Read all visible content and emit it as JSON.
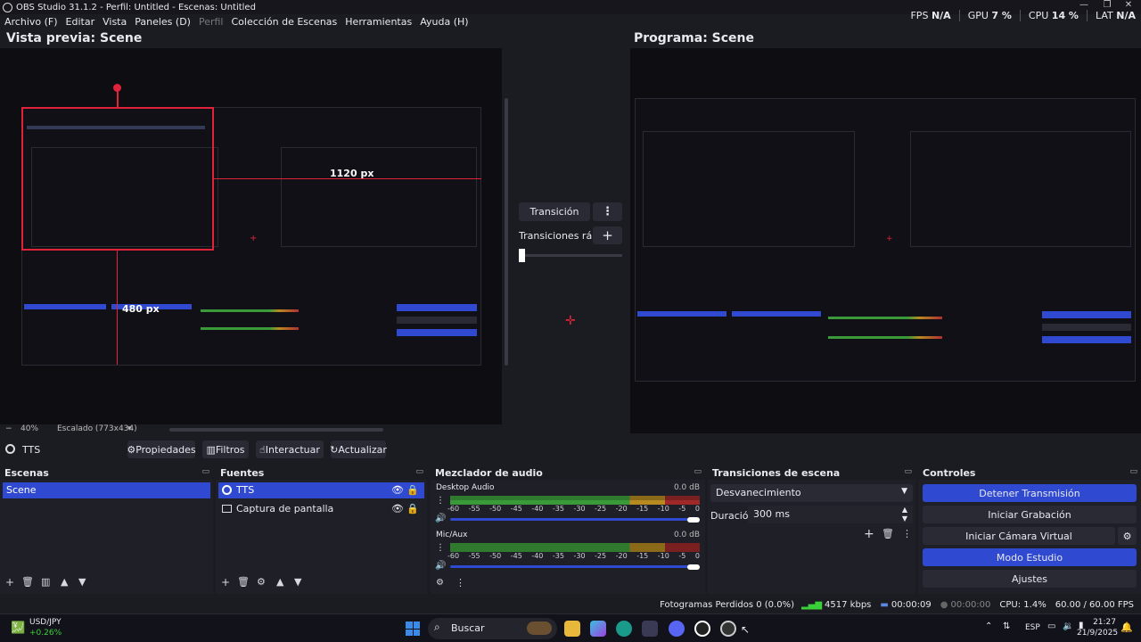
{
  "window": {
    "title": "OBS Studio 31.1.2 - Perfil: Untitled - Escenas: Untitled",
    "min": "—",
    "max": "❐",
    "close": "✕"
  },
  "menu": [
    "Archivo (F)",
    "Editar",
    "Vista",
    "Paneles (D)",
    "Perfil",
    "Colección de Escenas",
    "Herramientas",
    "Ayuda (H)"
  ],
  "stats": {
    "fps_label": "FPS",
    "fps": "N/A",
    "gpu_label": "GPU",
    "gpu": "7 %",
    "cpu_label": "CPU",
    "cpu": "14 %",
    "lat_label": "LAT",
    "lat": "N/A"
  },
  "preview": {
    "title": "Vista previa: Scene",
    "zoom": "40%",
    "scaling": "Escalado (773x434)",
    "dim1": "1120 px",
    "dim2": "480 px"
  },
  "program": {
    "title": "Programa: Scene"
  },
  "transition_center": {
    "button": "Transición",
    "quick": "Transiciones rápidas"
  },
  "source_toolbar": {
    "source": "TTS",
    "props": "Propiedades",
    "filters": "Filtros",
    "interact": "Interactuar",
    "refresh": "Actualizar"
  },
  "scenes": {
    "title": "Escenas",
    "items": [
      "Scene"
    ]
  },
  "sources": {
    "title": "Fuentes",
    "items": [
      "TTS",
      "Captura de pantalla"
    ]
  },
  "mixer": {
    "title": "Mezclador de audio",
    "ticks": [
      "-60",
      "-55",
      "-50",
      "-45",
      "-40",
      "-35",
      "-30",
      "-25",
      "-20",
      "-15",
      "-10",
      "-5",
      "0"
    ],
    "channels": [
      {
        "name": "Desktop Audio",
        "db": "0.0 dB"
      },
      {
        "name": "Mic/Aux",
        "db": "0.0 dB"
      }
    ]
  },
  "transitions": {
    "title": "Transiciones de escena",
    "selected": "Desvanecimiento",
    "duration_label": "Duración",
    "duration": "300 ms"
  },
  "controls": {
    "title": "Controles",
    "stop_stream": "Detener Transmisión",
    "start_rec": "Iniciar Grabación",
    "virtual_cam": "Iniciar Cámara Virtual",
    "studio": "Modo Estudio",
    "settings": "Ajustes"
  },
  "status": {
    "dropped": "Fotogramas Perdidos 0 (0.0%)",
    "bitrate": "4517 kbps",
    "stream_time": "00:00:09",
    "rec_time": "00:00:00",
    "cpu": "CPU: 1.4%",
    "fps": "60.00 / 60.00 FPS"
  },
  "taskbar": {
    "ticker": "USD/JPY",
    "change": "+0.26%",
    "search": "Buscar",
    "lang": "ESP",
    "time": "21:27",
    "date": "21/9/2025"
  },
  "colors": {
    "accent": "#2f4ad0",
    "bg": "#1b1b22",
    "panel": "#1f1f27",
    "record_red": "#e0223a"
  }
}
